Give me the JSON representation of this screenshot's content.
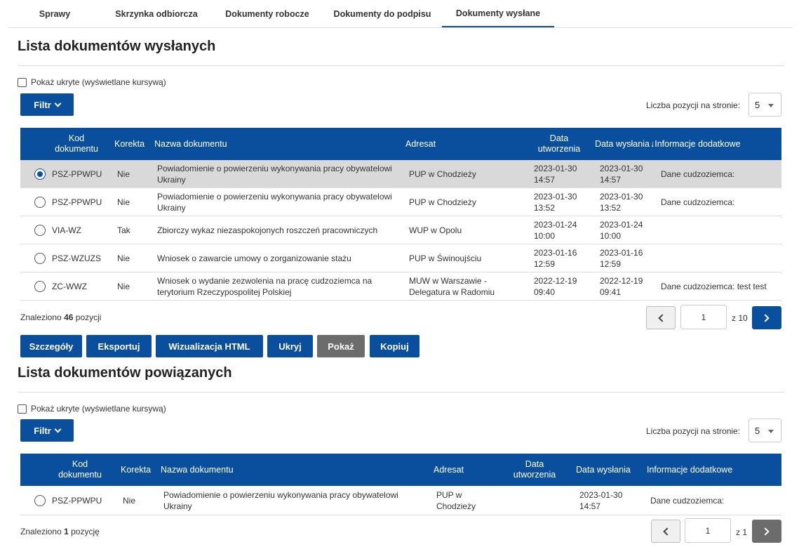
{
  "tabs": [
    {
      "label": "Sprawy"
    },
    {
      "label": "Skrzynka odbiorcza"
    },
    {
      "label": "Dokumenty robocze"
    },
    {
      "label": "Dokumenty do podpisu"
    },
    {
      "label": "Dokumenty wysłane"
    }
  ],
  "sent": {
    "title": "Lista dokumentów wysłanych",
    "show_hidden": "Pokaż ukryte (wyświetlane kursywą)",
    "filter": "Filtr",
    "per_page_label": "Liczba pozycji na stronie:",
    "per_page_value": "5",
    "columns": {
      "code": "Kod dokumentu",
      "correction": "Korekta",
      "name": "Nazwa dokumentu",
      "addressee": "Adresat",
      "created": "Data utworzenia",
      "sent": "Data wysłania",
      "info": "↓Informacje dodatkowe"
    },
    "rows": [
      {
        "code": "PSZ-PPWPU",
        "correction": "Nie",
        "name": "Powiadomienie o powierzeniu wykonywania pracy obywatelowi Ukrainy",
        "addressee": "PUP w Chodzieży",
        "created": "2023-01-30 14:57",
        "sent": "2023-01-30 14:57",
        "info": "Dane cudzoziemca:",
        "selected": true
      },
      {
        "code": "PSZ-PPWPU",
        "correction": "Nie",
        "name": "Powiadomienie o powierzeniu wykonywania pracy obywatelowi Ukrainy",
        "addressee": "PUP w Chodzieży",
        "created": "2023-01-30 13:52",
        "sent": "2023-01-30 13:52",
        "info": "Dane cudzoziemca:",
        "selected": false
      },
      {
        "code": "VIA-WZ",
        "correction": "Tak",
        "name": "Zbiorczy wykaz niezaspokojonych roszczeń pracowniczych",
        "addressee": "WUP w Opolu",
        "created": "2023-01-24 10:00",
        "sent": "2023-01-24 10:00",
        "info": "",
        "selected": false
      },
      {
        "code": "PSZ-WZUZS",
        "correction": "Nie",
        "name": "Wniosek o zawarcie umowy o zorganizowanie stażu",
        "addressee": "PUP w Świnoujściu",
        "created": "2023-01-16 12:59",
        "sent": "2023-01-16 12:59",
        "info": "",
        "selected": false
      },
      {
        "code": "ZC-WWZ",
        "correction": "Nie",
        "name": "Wniosek o wydanie zezwolenia na pracę cudzoziemca na terytorium Rzeczypospolitej Polskiej",
        "addressee": "MUW w Warszawie - Delegatura w Radomiu",
        "created": "2022-12-19 09:40",
        "sent": "2022-12-19 09:41",
        "info": "Dane cudzoziemca: test test",
        "selected": false
      }
    ],
    "found_prefix": "Znaleziono",
    "found_count": "46",
    "found_suffix": "pozycji",
    "page": "1",
    "of_pages": "z 10"
  },
  "actions": {
    "details": "Szczegóły",
    "export": "Eksportuj",
    "html": "Wizualizacja HTML",
    "hide": "Ukryj",
    "show": "Pokaż",
    "copy": "Kopiuj"
  },
  "related": {
    "title": "Lista dokumentów powiązanych",
    "show_hidden": "Pokaż ukryte (wyświetlane kursywą)",
    "filter": "Filtr",
    "per_page_label": "Liczba pozycji na stronie:",
    "per_page_value": "5",
    "columns": {
      "code": "Kod dokumentu",
      "correction": "Korekta",
      "name": "Nazwa dokumentu",
      "addressee": "Adresat",
      "created": "Data utworzenia",
      "sent": "Data wysłania",
      "info": "Informacje dodatkowe"
    },
    "rows": [
      {
        "code": "PSZ-PPWPU",
        "correction": "Nie",
        "name": "Powiadomienie o powierzeniu wykonywania pracy obywatelowi Ukrainy",
        "addressee": "PUP w Chodzieży",
        "created": "",
        "sent": "2023-01-30 14:57",
        "info": "Dane cudzoziemca:"
      }
    ],
    "found_prefix": "Znaleziono",
    "found_count": "1",
    "found_suffix": "pozycję",
    "page": "1",
    "of_pages": "z 1"
  }
}
